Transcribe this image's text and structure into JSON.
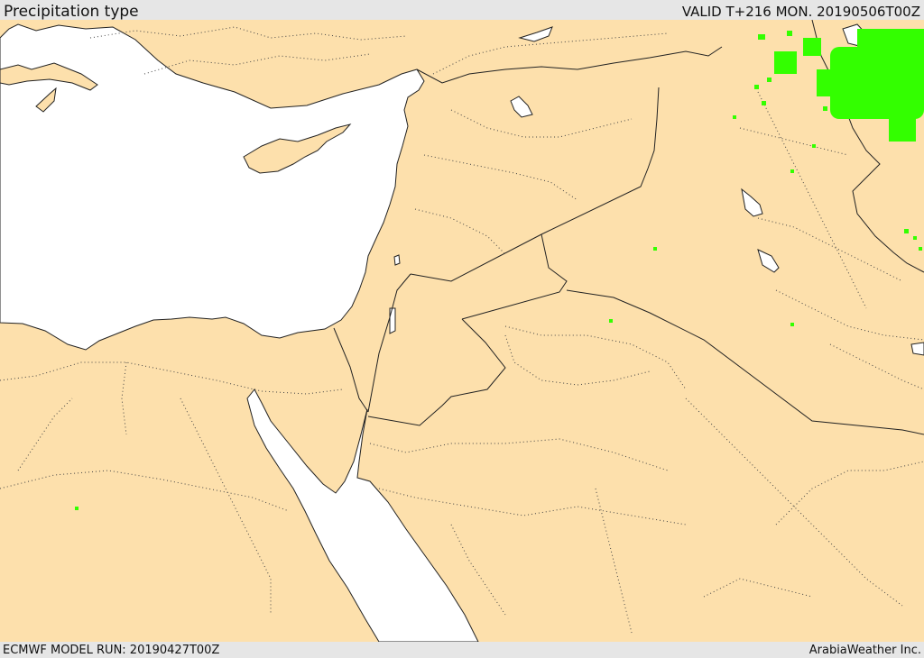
{
  "header": {
    "title": "Precipitation type",
    "valid": "VALID T+216 MON. 20190506T00Z"
  },
  "footer": {
    "model_run": "ECMWF MODEL RUN: 20190427T00Z",
    "credit": "ArabiaWeather Inc."
  },
  "map": {
    "region": "Eastern Mediterranean / Middle East",
    "colors": {
      "land": "#fde0ac",
      "water": "#ffffff",
      "precip_rain": "#33ff00",
      "border": "#222222",
      "province": "#333333"
    },
    "precip_legend_hidden": true
  }
}
